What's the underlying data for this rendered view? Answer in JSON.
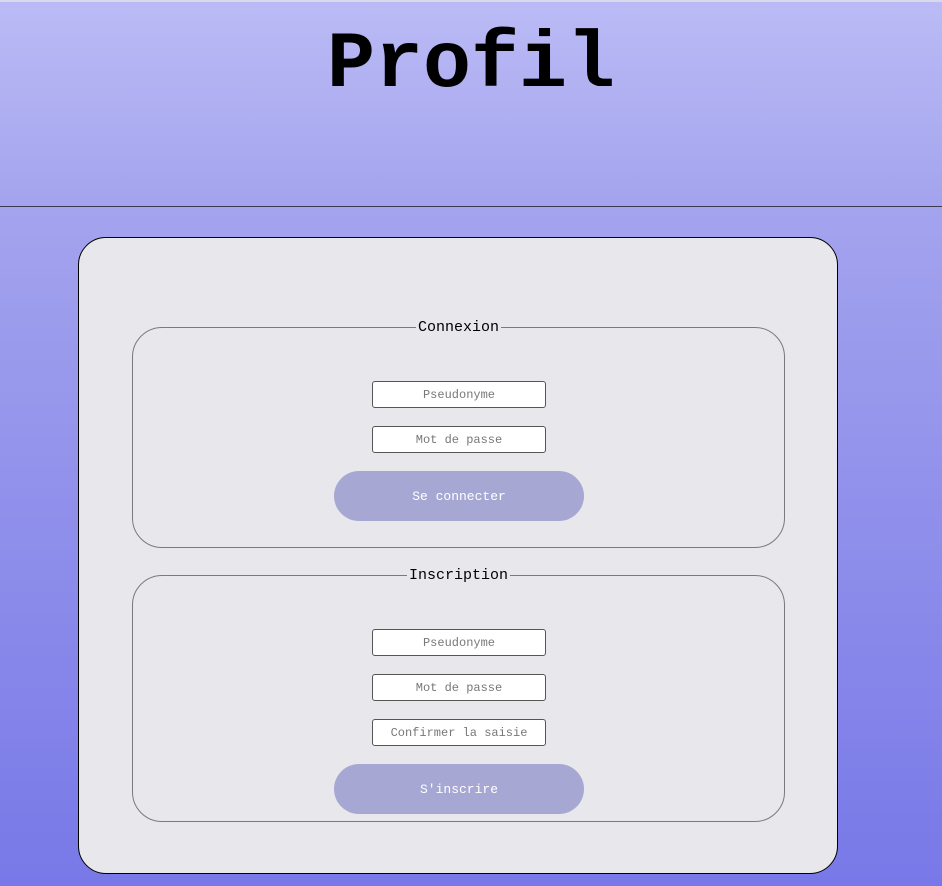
{
  "header": {
    "title": "Profil"
  },
  "login": {
    "legend": "Connexion",
    "username_placeholder": "Pseudonyme",
    "password_placeholder": "Mot de passe",
    "submit_label": "Se connecter"
  },
  "signup": {
    "legend": "Inscription",
    "username_placeholder": "Pseudonyme",
    "password_placeholder": "Mot de passe",
    "confirm_placeholder": "Confirmer la saisie",
    "submit_label": "S'inscrire"
  },
  "colors": {
    "header_gradient_top": "#bbbbf6",
    "background_gradient_bottom": "#7878e8",
    "card_background": "#e8e7ec",
    "button_background": "#a7a7d4",
    "button_text": "#ffffff"
  }
}
